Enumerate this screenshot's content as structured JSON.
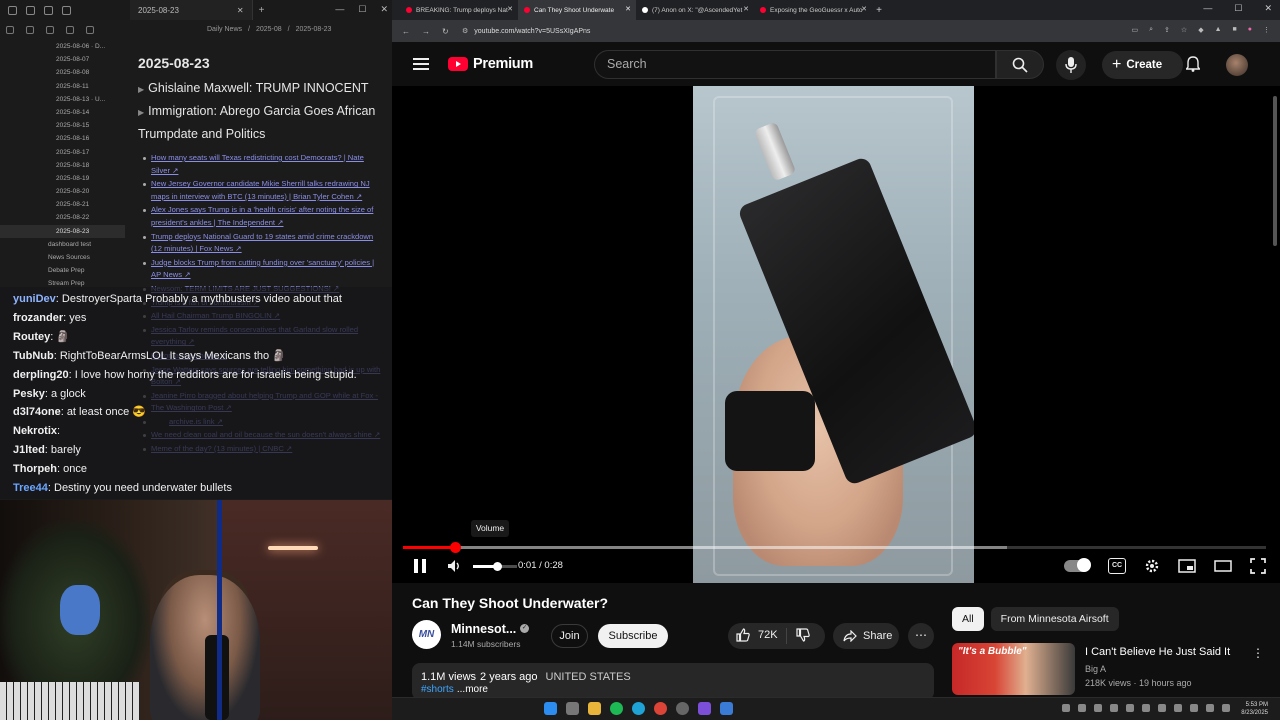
{
  "notes_app": {
    "tab_title": "2025-08-23",
    "breadcrumb": [
      "Daily News",
      "2025-08",
      "2025-08-23"
    ],
    "sidebar_items": [
      "2025-08-06 · D...",
      "2025-08-07",
      "2025-08-08",
      "2025-08-11",
      "2025-08-13 · U...",
      "2025-08-14",
      "2025-08-15",
      "2025-08-16",
      "2025-08-17",
      "2025-08-18",
      "2025-08-19",
      "2025-08-20",
      "2025-08-21",
      "2025-08-22",
      "2025-08-23",
      "dashboard test",
      "News Sources",
      "Debate Prep",
      "Stream Prep"
    ],
    "selected_item": "2025-08-23",
    "doc_title": "2025-08-23",
    "headings": [
      "Ghislaine Maxwell: TRUMP INNOCENT",
      "Immigration: Abrego Garcia Goes African",
      "Trumpdate and Politics"
    ],
    "links": [
      "How many seats will Texas redistricting cost Democrats? | Nate Silver",
      "New Jersey Governor candidate Mikie Sherrill talks redrawing NJ maps in interview with BTC (13 minutes) | Brian Tyler Cohen",
      "Alex Jones says Trump is in a 'health crisis' after noting the size of president's ankles | The Independent",
      "Trump deploys National Guard to 19 states amid crime crackdown (12 minutes) | Fox News",
      "Judge blocks Trump from cutting funding over 'sanctuary' policies | AP News",
      "Newsom: TERM LIMITS ARE JUST SUGGESTIONS!",
      "Trump is a fan of communism",
      "All Hail Chairman Trump BINGOLIN",
      "Jessica Tarlov reminds conservatives that Garland slow rolled everything",
      "Bolton arrives home",
      "Jesse Watters says sources are telling him something bad is up with Bolton",
      "Jeanine Pirro bragged about helping Trump and GOP while at Fox - The Washington Post",
      "archive.is link",
      "We need clean coal and oil because the sun doesn't always shine",
      "Meme of the day? (13 minutes) | CNBC"
    ]
  },
  "chat": [
    {
      "user": "yuniDev",
      "color": "#8fb4ff",
      "msg": "DestroyerSparta Probably a mythbusters video about that"
    },
    {
      "user": "frozander",
      "color": "#f0f0f0",
      "msg": "yes"
    },
    {
      "user": "Routey",
      "color": "#f0f0f0",
      "msg": "🗿"
    },
    {
      "user": "TubNub",
      "color": "#f0f0f0",
      "msg": "RightToBearArmsLOL It says Mexicans tho 🗿"
    },
    {
      "user": "derpling20",
      "color": "#f0f0f0",
      "msg": "I love how horny the redditors are for israelis being stupid."
    },
    {
      "user": "Pesky",
      "color": "#f0f0f0",
      "msg": "a glock"
    },
    {
      "user": "d3l74one",
      "color": "#f0f0f0",
      "msg": "at least once 😎"
    },
    {
      "user": "Nekrotix",
      "color": "#f0f0f0",
      "msg": ""
    },
    {
      "user": "J1lted",
      "color": "#f0f0f0",
      "msg": "barely"
    },
    {
      "user": "Thorpeh",
      "color": "#f0f0f0",
      "msg": "once"
    },
    {
      "user": "Tree44",
      "color": "#6aa6ff",
      "msg": "Destiny you need underwater bullets"
    }
  ],
  "browser": {
    "tabs": [
      {
        "title": "BREAKING: Trump deploys Nat",
        "fav": "#ff0033",
        "active": false
      },
      {
        "title": "Can They Shoot Underwate",
        "fav": "#ff0033",
        "active": true
      },
      {
        "title": "(7) Anon on X: \"@AscendedYet",
        "fav": "#ffffff",
        "active": false
      },
      {
        "title": "Exposing the GeoGuessr x Auto",
        "fav": "#ff0033",
        "active": false
      }
    ],
    "url": "youtube.com/watch?v=5USsXIgAPns"
  },
  "youtube": {
    "logo_text": "Premium",
    "search_placeholder": "Search",
    "create_label": "Create",
    "tooltip": "Volume",
    "progress_fraction": 0.06,
    "buffered_fraction": 0.7,
    "volume_fraction": 0.55,
    "time_current": "0:01",
    "time_total": "0:28",
    "video_title": "Can They Shoot Underwater?",
    "channel_initials": "MN",
    "channel_name": "Minnesot...",
    "subscribers": "1.14M subscribers",
    "join_label": "Join",
    "subscribe_label": "Subscribe",
    "likes": "72K",
    "share_label": "Share",
    "views": "1.1M views",
    "age": "2 years ago",
    "location": "UNITED STATES",
    "hashtag": "#shorts",
    "more_label": "...more",
    "chips": [
      "All",
      "From Minnesota Airsoft"
    ],
    "recommended": {
      "thumb_text": "\"It's a Bubble\"",
      "title": "I Can't Believe He Just Said It",
      "channel": "Big A",
      "meta": "218K views · 19 hours ago"
    }
  },
  "taskbar": {
    "time": "5:53 PM",
    "date": "8/23/2025"
  }
}
